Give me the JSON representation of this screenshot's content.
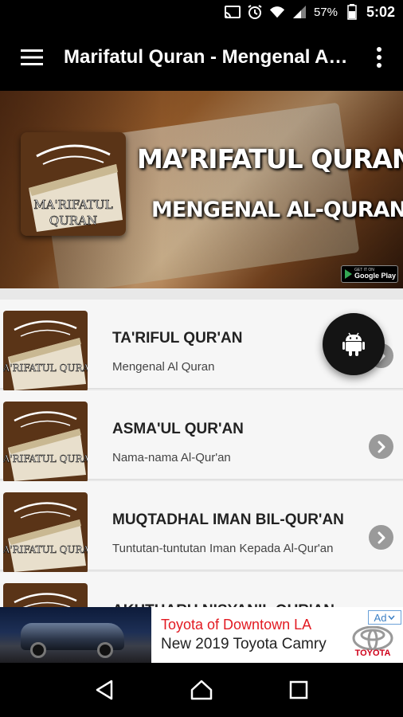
{
  "status_bar": {
    "battery": "57%",
    "time": "5:02",
    "icons": [
      "cast-icon",
      "alarm-icon",
      "wifi-icon",
      "signal-icon",
      "battery-icon"
    ]
  },
  "app_bar": {
    "title": "Marifatul Quran - Mengenal Al-Quran",
    "menu_icon": "hamburger-icon",
    "more_icon": "more-vert-icon"
  },
  "banner": {
    "heading": "MA’RIFATUL QURAN",
    "subheading": "MENGENAL AL-QURAN",
    "logo_text": "MA'RIFATUL QURAN",
    "store_badge": {
      "top": "GET IT ON",
      "label": "Google Play"
    }
  },
  "list": {
    "items": [
      {
        "title": "TA'RIFUL QUR'AN",
        "subtitle": "Mengenal Al Quran"
      },
      {
        "title": "ASMA'UL QUR'AN",
        "subtitle": "Nama-nama Al-Qur'an"
      },
      {
        "title": "MUQTADHAL IMAN BIL-QUR'AN",
        "subtitle": "Tuntutan-tuntutan Iman Kepada Al-Qur'an"
      },
      {
        "title": "AKHTHARU NISYANIL QUR'AN",
        "subtitle": ""
      }
    ],
    "thumb_text": "MA'RIFATUL QURAN"
  },
  "fab": {
    "icon": "android-icon"
  },
  "ad": {
    "line1": "Toyota of Downtown LA",
    "line2": "New 2019 Toyota Camry",
    "badge": "Ad",
    "brand": "TOYOTA"
  },
  "nav_bar": {
    "icons": [
      "back-icon",
      "home-icon",
      "recents-icon"
    ]
  },
  "colors": {
    "bar": "#000000",
    "list_bg": "#f6f6f6",
    "ad_red": "#e21a22",
    "chevron": "#9a9a9a"
  }
}
